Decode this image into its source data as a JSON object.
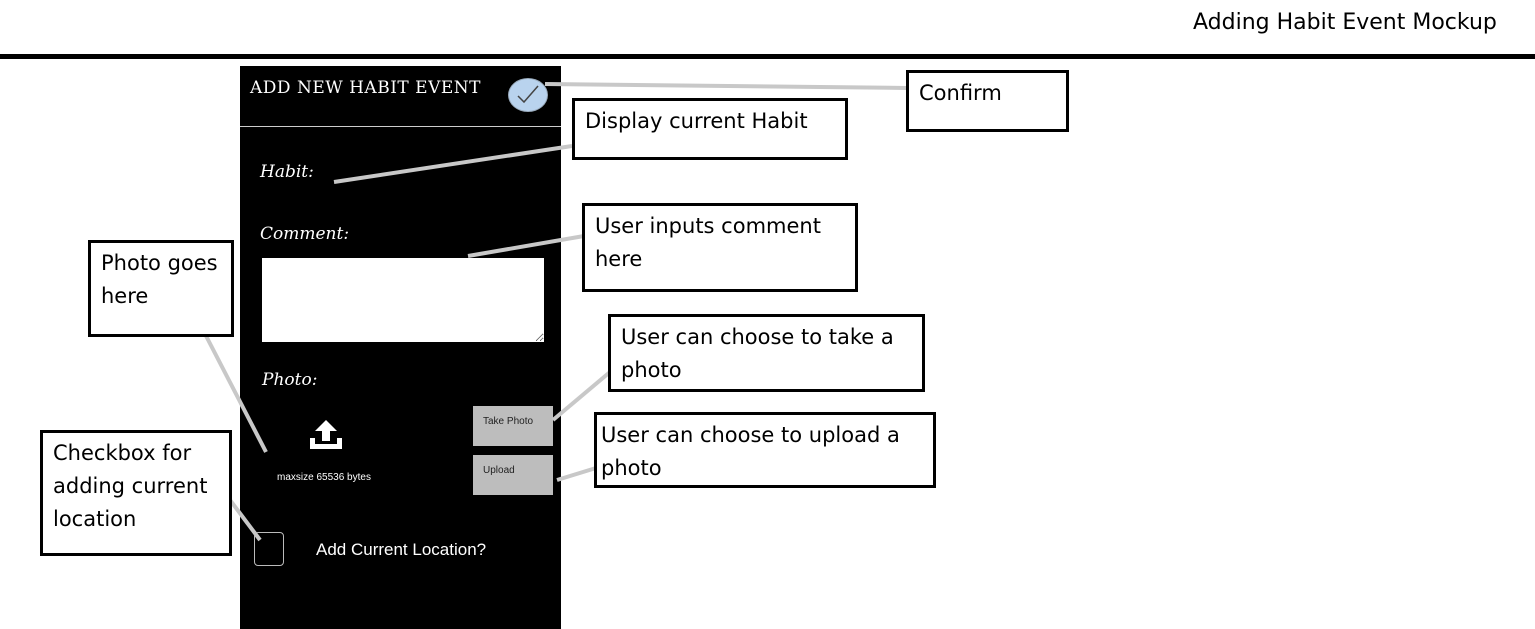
{
  "page": {
    "title": "Adding Habit Event Mockup"
  },
  "app": {
    "title": "ADD NEW HABIT EVENT",
    "confirm_icon": "checkmark-icon",
    "habit_label": "Habit:",
    "comment_label": "Comment:",
    "comment_value": "",
    "photo_label": "Photo:",
    "upload_icon": "upload-icon",
    "maxsize_text": "maxsize 65536 bytes",
    "take_photo_label": "Take Photo",
    "upload_label": "Upload",
    "location_label": "Add Current Location?",
    "location_checked": false
  },
  "annotations": {
    "confirm": "Confirm",
    "display_habit": "Display current Habit",
    "comment": "User inputs comment here",
    "photo": "Photo goes here",
    "take_photo": "User can choose to take a photo",
    "upload": "User can choose to upload a photo",
    "checkbox": "Checkbox for adding current location"
  },
  "colors": {
    "panel_bg": "#000000",
    "button_gray": "#bdbdbd",
    "confirm_blue": "#b9d3ee",
    "leader_gray": "#c8c8c8"
  }
}
